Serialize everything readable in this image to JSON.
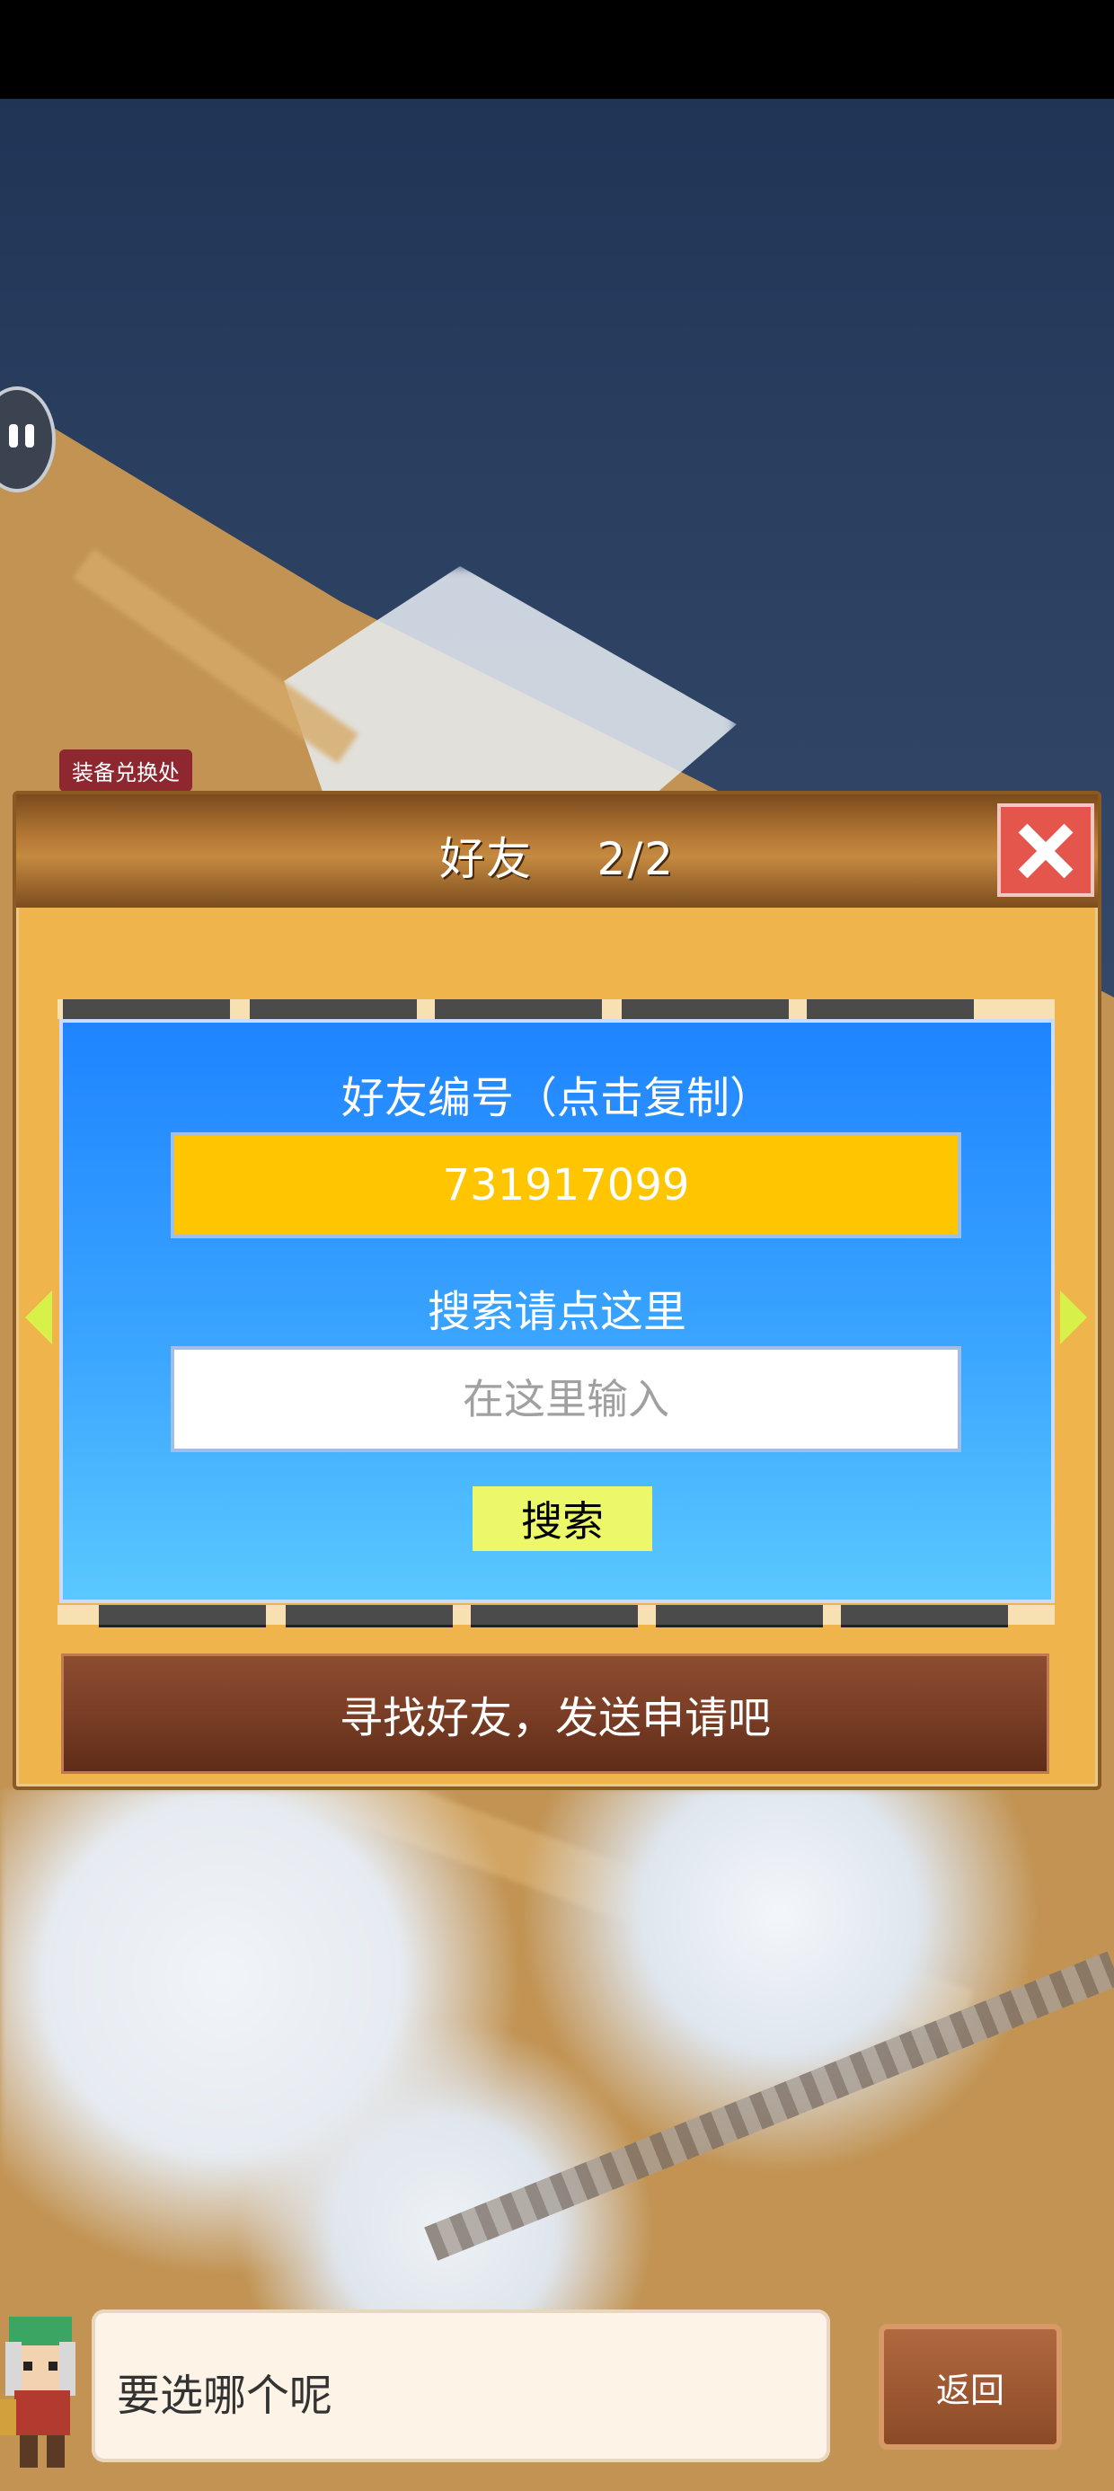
{
  "map": {
    "building_labels": [
      "装备兑换处"
    ]
  },
  "dialog": {
    "title": "好友",
    "page_indicator": "2/2",
    "friend_id_label": "好友编号（点击复制）",
    "friend_id_value": "731917099",
    "search_label": "搜索请点这里",
    "search_placeholder": "在这里输入",
    "search_value": "",
    "search_button": "搜索",
    "find_friends_button": "寻找好友，发送申请吧"
  },
  "bottom_bar": {
    "prompt": "要选哪个呢",
    "back_button": "返回"
  },
  "icons": {
    "close": "close-icon",
    "prev": "arrow-left-icon",
    "next": "arrow-right-icon",
    "menu": "pause-icon",
    "avatar": "character-avatar"
  }
}
